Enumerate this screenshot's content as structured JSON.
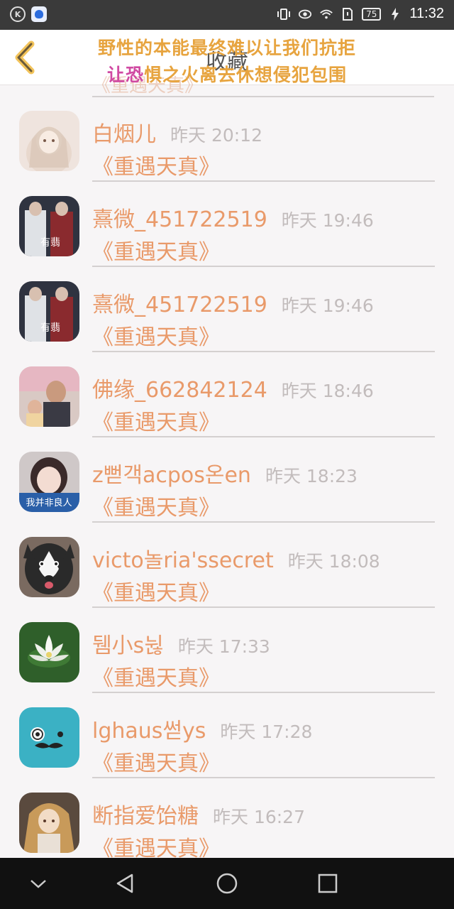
{
  "status_bar": {
    "time": "11:32",
    "battery": "75",
    "left_icons": [
      "k-circle-icon",
      "baidu-icon"
    ],
    "right_icons": [
      "vibrate-icon",
      "eye-icon",
      "wifi-icon",
      "sim-icon",
      "battery-icon",
      "charging-icon"
    ]
  },
  "header": {
    "title": "收藏",
    "overlay_line1": "野性的本能最终难以让我们抗拒",
    "overlay_line2_pink": "让恐",
    "overlay_line2_rest": "惧之火离去休想侵犯包围",
    "partial_row": "《重遇天真》"
  },
  "colors": {
    "accent": "#e99a6a",
    "time_gray": "#c2bcbc",
    "overlay_yellow": "#e7a43f",
    "overlay_pink": "#d04aa2",
    "background": "#f7f5f6"
  },
  "items": [
    {
      "name": "白烟儿",
      "time": "昨天 20:12",
      "subtitle": "《重遇天真》",
      "avatar": "anime-girl-avatar"
    },
    {
      "name": "熹微_451722519",
      "time": "昨天 19:46",
      "subtitle": "《重遇天真》",
      "avatar": "drama-poster-avatar"
    },
    {
      "name": "熹微_451722519",
      "time": "昨天 19:46",
      "subtitle": "《重遇天真》",
      "avatar": "drama-poster-avatar"
    },
    {
      "name": "佛缘_662842124",
      "time": "昨天 18:46",
      "subtitle": "《重遇天真》",
      "avatar": "family-photo-avatar"
    },
    {
      "name": "z뻗객acpos온en",
      "time": "昨天 18:23",
      "subtitle": "《重遇天真》",
      "avatar": "girl-photo-avatar",
      "avatar_caption": "我并非良人"
    },
    {
      "name": "victo놀ria'ssecret",
      "time": "昨天 18:08",
      "subtitle": "《重遇天真》",
      "avatar": "husky-avatar"
    },
    {
      "name": "뒘小s뉞",
      "time": "昨天 17:33",
      "subtitle": "《重遇天真》",
      "avatar": "lotus-avatar"
    },
    {
      "name": "lghaus썯ys",
      "time": "昨天 17:28",
      "subtitle": "《重遇天真》",
      "avatar": "cartoon-mustache-avatar"
    },
    {
      "name": "断指爱饴糖",
      "time": "昨天 16:27",
      "subtitle": "《重遇天真》",
      "avatar": "anime-longhair-avatar"
    }
  ],
  "nav_bar": {
    "buttons": [
      "collapse-icon",
      "back-triangle-icon",
      "home-circle-icon",
      "recents-square-icon"
    ]
  }
}
